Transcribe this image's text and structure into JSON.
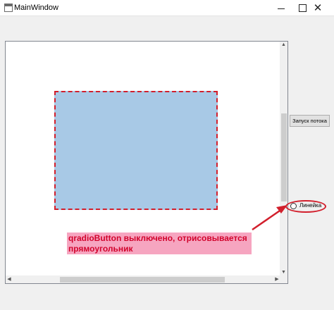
{
  "window": {
    "title": "MainWindow",
    "controls": {
      "minimize": "—",
      "maximize": "□",
      "close": "✕"
    }
  },
  "canvas": {
    "shape": "rectangle",
    "fill_color": "#a8c9e6",
    "border_color": "#d21f2c",
    "border_style": "dashed"
  },
  "buttons": {
    "start_label": "Запуск потока"
  },
  "radio": {
    "label": "Линейка",
    "checked": false
  },
  "annotation": {
    "text": "qradioButton выключено, отрисовывается прямоугольник",
    "highlight_color": "#f6a5c0",
    "text_color": "#d2042d"
  },
  "icons": {
    "app": "window-app-icon",
    "scroll_up": "▲",
    "scroll_down": "▼",
    "scroll_left": "◀",
    "scroll_right": "▶"
  }
}
